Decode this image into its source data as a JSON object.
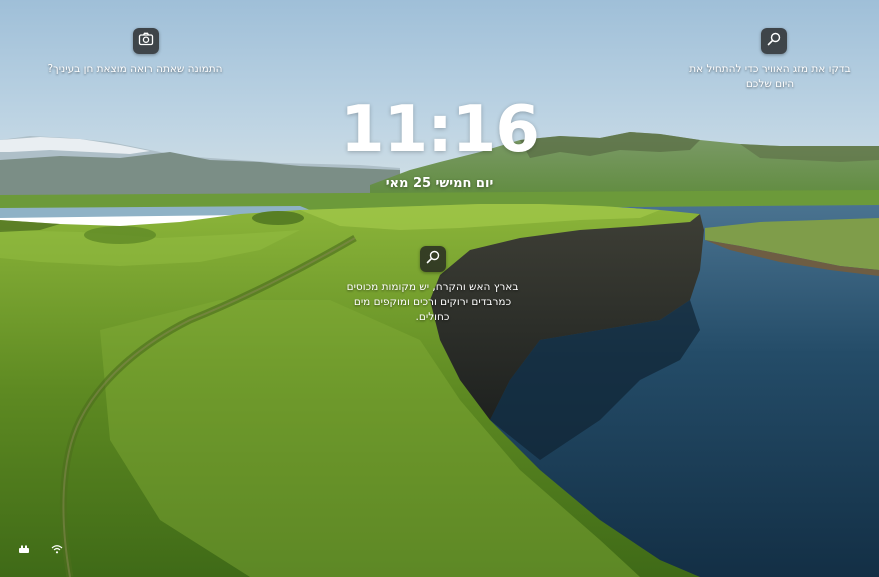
{
  "lock_screen": {
    "time": "11:16",
    "date": "יום חמישי 25 מאי"
  },
  "spotlight": {
    "like_prompt": "התמונה שאתה רואה מוצאת חן בעיניך?",
    "top_right_info_line1": "בדקו את מזג האוויר כדי להתחיל את",
    "top_right_info_line2": "היום שלכם",
    "center_info_line1": "בארץ האש והקרח, יש מקומות מכוסים",
    "center_info_line2": "כמרבדים ירוקים ורכים ומוקפים מים",
    "center_info_line3": "כחולים."
  },
  "icons": {
    "camera": "camera-icon",
    "search_top_right": "search-icon",
    "search_center": "search-icon",
    "tray_left": "network-icon",
    "tray_right": "wifi-icon"
  },
  "colors": {
    "chip_bg": "#202020",
    "text": "#ffffff",
    "sky": "#aac9e2",
    "grass": "#6f9a2e",
    "water": "#1d3e57"
  }
}
